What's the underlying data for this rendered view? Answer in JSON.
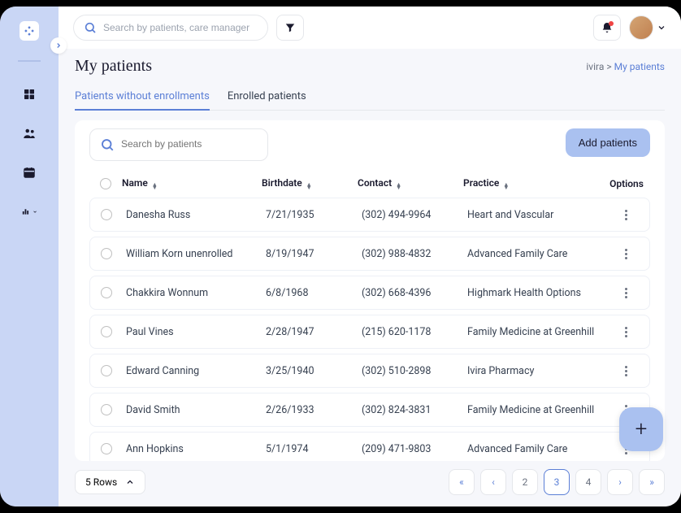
{
  "search": {
    "top_placeholder": "Search by patients, care manager",
    "table_placeholder": "Search by patients"
  },
  "page": {
    "title": "My patients"
  },
  "breadcrumb": {
    "root": "ivira",
    "sep": ">",
    "current": "My patients"
  },
  "tabs": {
    "without": "Patients without enrollments",
    "enrolled": "Enrolled patients"
  },
  "toolbar": {
    "add_label": "Add patients"
  },
  "headers": {
    "name": "Name",
    "birth": "Birthdate",
    "contact": "Contact",
    "practice": "Practice",
    "options": "Options"
  },
  "rows": [
    {
      "name": "Danesha Russ",
      "birth": "7/21/1935",
      "contact": "(302) 494-9964",
      "practice": "Heart and Vascular"
    },
    {
      "name": "William Korn unenrolled",
      "birth": "8/19/1947",
      "contact": "(302) 988-4832",
      "practice": "Advanced Family Care"
    },
    {
      "name": "Chakkira Wonnum",
      "birth": "6/8/1968",
      "contact": "(302) 668-4396",
      "practice": "Highmark Health Options"
    },
    {
      "name": "Paul Vines",
      "birth": "2/28/1947",
      "contact": "(215) 620-1178",
      "practice": "Family Medicine at Greenhill"
    },
    {
      "name": "Edward Canning",
      "birth": "3/25/1940",
      "contact": "(302) 510-2898",
      "practice": "Ivira Pharmacy"
    },
    {
      "name": "David Smith",
      "birth": "2/26/1933",
      "contact": "(302) 824-3831",
      "practice": "Family Medicine at Greenhill"
    },
    {
      "name": "Ann Hopkins",
      "birth": "5/1/1974",
      "contact": "(209) 471-9803",
      "practice": "Advanced Family Care"
    }
  ],
  "footer": {
    "rows_label": "5 Rows"
  },
  "pagination": {
    "pages": [
      "2",
      "3",
      "4"
    ],
    "active": "3"
  },
  "fab": {
    "label": "+"
  }
}
